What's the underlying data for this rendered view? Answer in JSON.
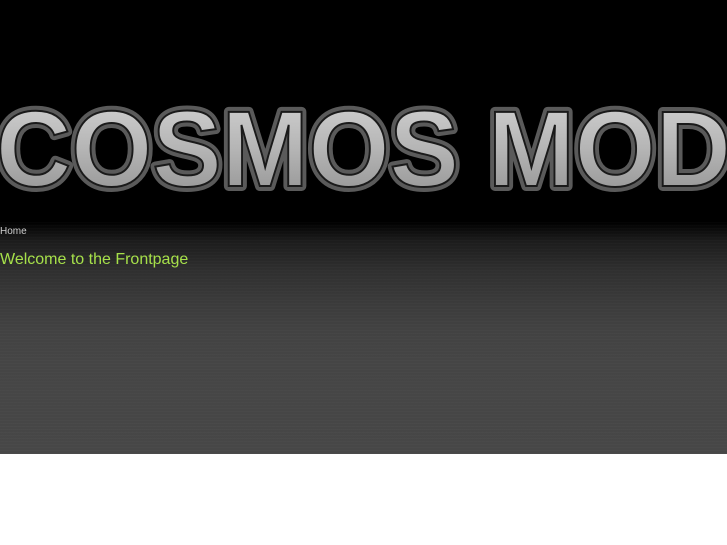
{
  "header": {
    "logo_text": "COSMOS MOD"
  },
  "breadcrumb": {
    "home_label": "Home"
  },
  "main": {
    "title": "Welcome to the Frontpage"
  },
  "colors": {
    "title_green": "#a6e04a",
    "logo_fill": "#b7b7b7",
    "background_dark": "#000000",
    "background_gray": "#474747"
  }
}
